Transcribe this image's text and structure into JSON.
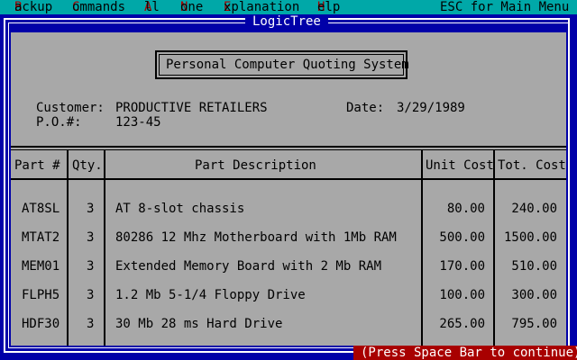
{
  "menu": {
    "items": [
      {
        "hot": "B",
        "rest": "ackup"
      },
      {
        "hot": "C",
        "rest": "ommands"
      },
      {
        "hot": "A",
        "rest": "ll"
      },
      {
        "hot": "N",
        "rest": "one"
      },
      {
        "hot": "E",
        "rest": "xplanation"
      },
      {
        "hot": "H",
        "rest": "elp"
      }
    ],
    "esc": "ESC for Main Menu"
  },
  "window": {
    "title": "LogicTree"
  },
  "form": {
    "heading": "Personal Computer Quoting System",
    "customer_label": "Customer:",
    "customer_value": "PRODUCTIVE RETAILERS",
    "po_label": "P.O.#:",
    "po_value": "123-45",
    "date_label": "Date:",
    "date_value": "3/29/1989"
  },
  "table": {
    "headers": [
      "Part #",
      "Qty.",
      "Part Description",
      "Unit Cost",
      "Tot. Cost"
    ],
    "rows": [
      {
        "part": "AT8SL",
        "qty": "3",
        "desc": "AT 8-slot chassis",
        "unit": "80.00",
        "total": "240.00"
      },
      {
        "part": "MTAT2",
        "qty": "3",
        "desc": "80286 12 Mhz Motherboard with 1Mb RAM",
        "unit": "500.00",
        "total": "1500.00"
      },
      {
        "part": "MEM01",
        "qty": "3",
        "desc": "Extended Memory Board with 2 Mb RAM",
        "unit": "170.00",
        "total": "510.00"
      },
      {
        "part": "FLPH5",
        "qty": "3",
        "desc": "1.2 Mb 5-1/4 Floppy Drive",
        "unit": "100.00",
        "total": "300.00"
      },
      {
        "part": "HDF30",
        "qty": "3",
        "desc": "30 Mb 28 ms Hard Drive",
        "unit": "265.00",
        "total": "795.00"
      }
    ]
  },
  "status": {
    "text": "(Press Space Bar to continue)"
  },
  "colors": {
    "desktop": "#0000a8",
    "menu": "#00a8a8",
    "hotkey": "#a80000",
    "panel": "#a8a8a8",
    "status": "#a80000"
  }
}
